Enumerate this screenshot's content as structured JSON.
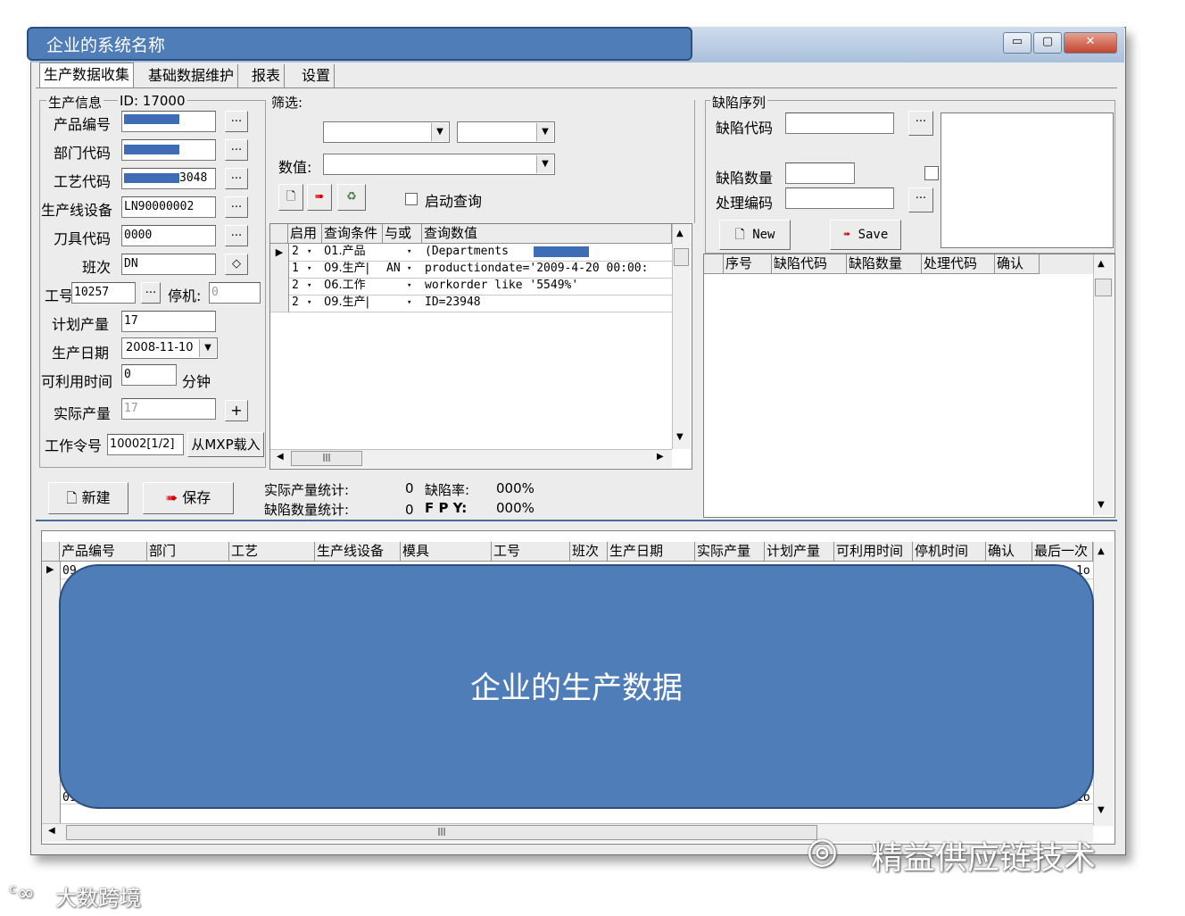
{
  "title_overlay": "企业的系统名称",
  "window_buttons": {
    "minimize": "▭",
    "maximize": "▢",
    "close": "✕"
  },
  "tabs": [
    "生产数据收集",
    "基础数据维护",
    "报表",
    "设置"
  ],
  "production": {
    "group_label": "生产信息",
    "id_label": "ID: 17000",
    "product_code_label": "产品编号",
    "dept_code_label": "部门代码",
    "process_code_label": "工艺代码",
    "process_code_suffix": "3048",
    "line_label": "生产线设备",
    "line_value": "LN90000002",
    "tool_label": "刀具代码",
    "tool_value": "0000",
    "shift_label": "班次",
    "shift_value": "DN",
    "worker_label": "工号",
    "worker_value": "10257",
    "stop_label": "停机:",
    "stop_value": "0",
    "plan_label": "计划产量",
    "plan_value": "17",
    "date_label": "生产日期",
    "date_value": "2008-11-10",
    "avail_label": "可利用时间",
    "avail_value": "0",
    "avail_unit": "分钟",
    "actual_label": "实际产量",
    "actual_value": "17",
    "order_label": "工作令号",
    "order_value": "10002[1/2]",
    "mxp_button": "从MXP载入",
    "ellipsis": "...",
    "plus": "+",
    "diamond": "◇",
    "new_button": "新建",
    "save_button": "保存"
  },
  "filter": {
    "label": "筛选:",
    "value_label": "数值:",
    "auto_query_label": "启动查询",
    "columns": [
      "启用",
      "查询条件",
      "与或",
      "查询数值"
    ],
    "rows": [
      {
        "enabled": "2",
        "cond": "01.产品",
        "op": "",
        "val": "(Departments"
      },
      {
        "enabled": "1",
        "cond": "09.生产|",
        "op": "AN",
        "val": "productiondate='2009-4-20 00:00:"
      },
      {
        "enabled": "2",
        "cond": "06.工作",
        "op": "",
        "val": "workorder like '5549%'"
      },
      {
        "enabled": "2",
        "cond": "09.生产|",
        "op": "",
        "val": "ID=23948"
      }
    ],
    "stats": {
      "actual_label": "实际产量统计:",
      "actual_value": "0",
      "defect_rate_label": "缺陷率:",
      "defect_rate_value": "000%",
      "defect_count_label": "缺陷数量统计:",
      "defect_count_value": "0",
      "fpy_label": "F P Y:",
      "fpy_value": "000%"
    }
  },
  "defect": {
    "group_label": "缺陷序列",
    "code_label": "缺陷代码",
    "qty_label": "缺陷数量",
    "handle_label": "处理编码",
    "new_button": "New",
    "save_button": "Save",
    "columns": [
      "序号",
      "缺陷代码",
      "缺陷数量",
      "处理代码",
      "确认"
    ]
  },
  "bottom_grid": {
    "columns": [
      "产品编号",
      "部门",
      "工艺",
      "生产线设备",
      "模具",
      "工号",
      "班次",
      "生产日期",
      "实际产量",
      "计划产量",
      "可利用时间",
      "停机时间",
      "确认",
      "最后一次"
    ],
    "first_cell": "09",
    "last_row_cell": "01",
    "right_cells": [
      "1o",
      "1o"
    ]
  },
  "overlay_text": "企业的生产数据",
  "watermarks": {
    "right": "精益供应链技术",
    "left": "大数跨境"
  },
  "colors": {
    "overlay_blue": "#4f7db8",
    "redaction_blue": "#3f6db5"
  }
}
